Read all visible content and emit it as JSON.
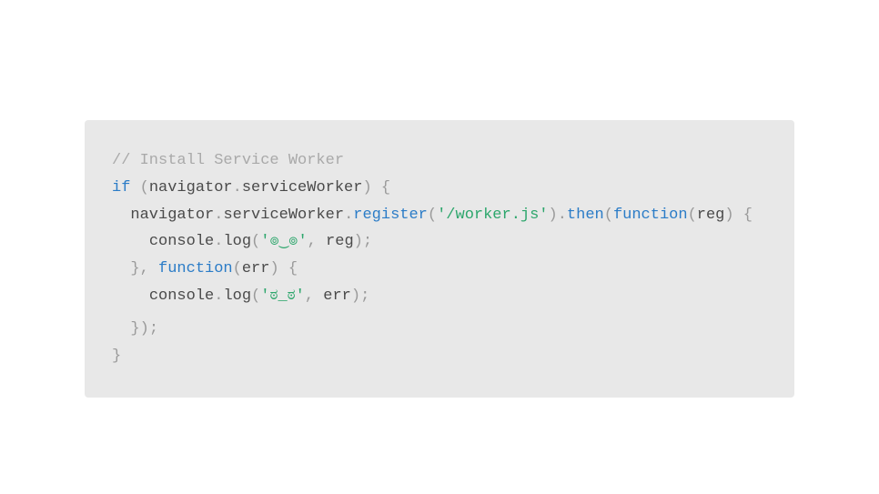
{
  "code": {
    "line1": {
      "comment": "// Install Service Worker"
    },
    "line2": {
      "if": "if",
      "sp": " ",
      "lp": "(",
      "nav": "navigator",
      "dot": ".",
      "sw": "serviceWorker",
      "rp": ")",
      "sp2": " ",
      "lb": "{"
    },
    "line3": {
      "indent": "  ",
      "nav": "navigator",
      "dot1": ".",
      "sw": "serviceWorker",
      "dot2": ".",
      "reg": "register",
      "lp1": "(",
      "str": "'/worker.js'",
      "rp1": ")",
      "dot3": ".",
      "then": "then",
      "lp2": "(",
      "func": "function",
      "lp3": "(",
      "arg": "reg",
      "rp3": ")",
      "sp": " ",
      "lb": "{"
    },
    "line4": {
      "indent": "    ",
      "console": "console",
      "dot": ".",
      "log": "log",
      "lp": "(",
      "str": "'๏‿๏'",
      "comma": ",",
      "sp": " ",
      "arg": "reg",
      "rp": ")",
      "semi": ";"
    },
    "line5": {
      "indent": "  ",
      "rb": "}",
      "comma": ",",
      "sp": " ",
      "func": "function",
      "lp": "(",
      "arg": "err",
      "rp": ")",
      "sp2": " ",
      "lb": "{"
    },
    "line6": {
      "indent": "    ",
      "console": "console",
      "dot": ".",
      "log": "log",
      "lp": "(",
      "str": "'ಠ_ಠ'",
      "comma": ",",
      "sp": " ",
      "arg": "err",
      "rp": ")",
      "semi": ";"
    },
    "line7": {
      "indent": "  ",
      "rb": "}",
      "rp": ")",
      "semi": ";"
    },
    "line8": {
      "rb": "}"
    }
  }
}
